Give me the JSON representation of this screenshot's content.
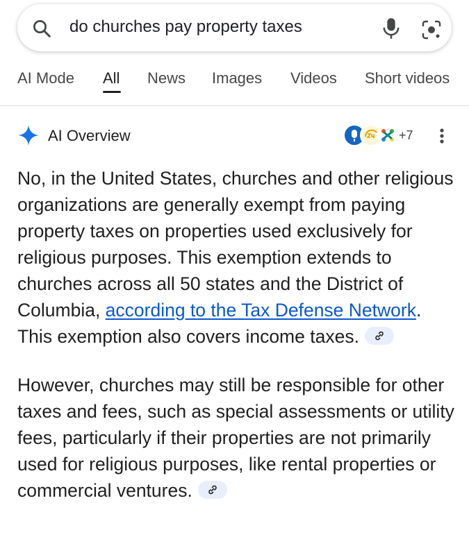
{
  "search": {
    "query": "do churches pay property taxes"
  },
  "tabs": [
    {
      "label": "AI Mode"
    },
    {
      "label": "All"
    },
    {
      "label": "News"
    },
    {
      "label": "Images"
    },
    {
      "label": "Videos"
    },
    {
      "label": "Short videos"
    }
  ],
  "active_tab": "All",
  "ai_overview": {
    "title": "AI Overview",
    "sources_more": "+7",
    "p1_part1": "No, in the United States, churches and other religious organizations are generally exempt from paying property taxes on properties used exclusively for religious purposes. This exemption extends to churches across all 50 states and the District of Columbia, ",
    "p1_link": "according to the Tax Defense Network",
    "p1_part2": ". This exemption also covers income taxes.",
    "p2": "However, churches may still be responsible for other taxes and fees, such as special assessments or utility fees, particularly if their properties are not primarily used for religious purposes, like rental properties or commercial ventures."
  },
  "colors": {
    "link": "#0b57d0",
    "sparkle": "#1a73e8",
    "chip_bg": "#e8eefc"
  }
}
